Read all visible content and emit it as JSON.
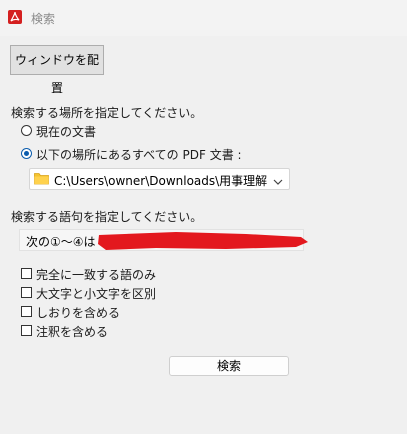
{
  "window": {
    "title": "検索",
    "arrange_button": "ウィンドウを配置"
  },
  "location": {
    "prompt": "検索する場所を指定してください。",
    "options": [
      {
        "label": "現在の文書",
        "selected": false
      },
      {
        "label": "以下の場所にあるすべての PDF 文書 :",
        "selected": true
      }
    ],
    "path": "C:\\Users\\owner\\Downloads\\用事理解"
  },
  "query": {
    "prompt": "検索する語句を指定してください。",
    "value": "次の①～④は「(",
    "redaction_color": "#e3181e"
  },
  "options": {
    "checkboxes": [
      {
        "label": "完全に一致する語のみ",
        "checked": false
      },
      {
        "label": "大文字と小文字を区別",
        "checked": false
      },
      {
        "label": "しおりを含める",
        "checked": false
      },
      {
        "label": "注釈を含める",
        "checked": false
      }
    ]
  },
  "actions": {
    "search_button": "検索"
  },
  "colors": {
    "accent": "#0b5cad",
    "app_icon": "#d41f1f",
    "folder": "#f4c430"
  },
  "icons": {
    "app": "acrobat-icon",
    "folder": "folder-icon",
    "dropdown": "chevron-down-icon"
  }
}
